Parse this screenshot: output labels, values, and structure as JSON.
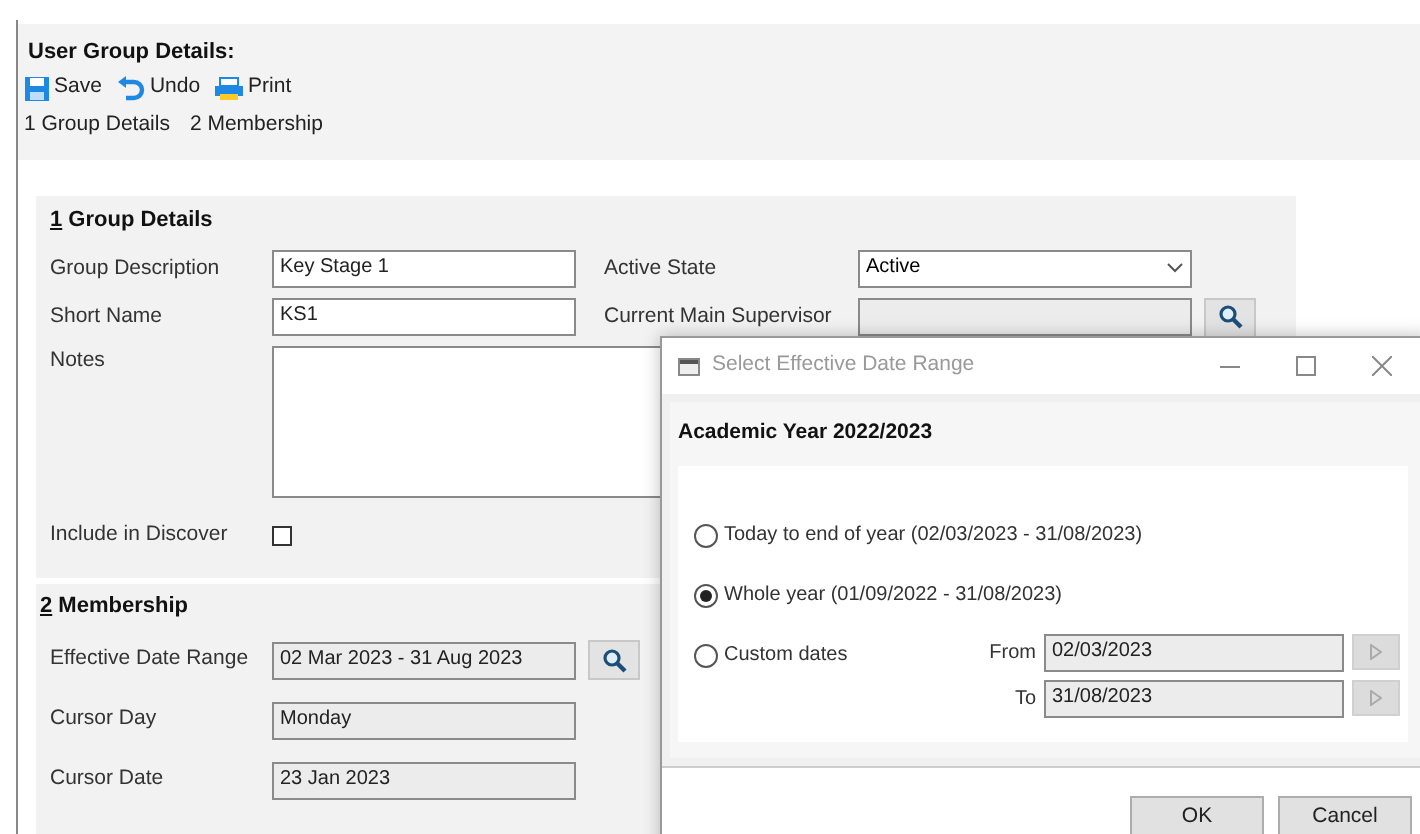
{
  "page_title": "User Group Details:",
  "toolbar": [
    {
      "kind": "save",
      "label": "Save"
    },
    {
      "kind": "undo",
      "label": "Undo"
    },
    {
      "kind": "print",
      "label": "Print"
    }
  ],
  "tabs": [
    {
      "label": "1 Group Details"
    },
    {
      "label": "2 Membership"
    }
  ],
  "group_details": {
    "title_key": "1",
    "title": " Group Details",
    "group_description": {
      "label": "Group Description",
      "value": "Key Stage 1"
    },
    "short_name": {
      "label": "Short Name",
      "value": "KS1"
    },
    "active_state": {
      "label": "Active State",
      "value": "Active"
    },
    "current_main_supervisor": {
      "label": "Current Main Supervisor"
    },
    "notes": {
      "label": "Notes"
    },
    "include_in_discover": {
      "label": "Include in Discover",
      "checked": false
    }
  },
  "membership": {
    "title_key": "2",
    "title": " Membership",
    "effective_date_range": {
      "label": "Effective Date Range",
      "value": "02 Mar 2023 - 31 Aug 2023"
    },
    "cursor_day": {
      "label": "Cursor Day",
      "value": "Monday"
    },
    "cursor_date": {
      "label": "Cursor Date",
      "value": "23 Jan 2023"
    }
  },
  "dialog": {
    "title": "Select Effective Date Range",
    "heading": "Academic Year 2022/2023",
    "options": [
      {
        "label": "Today to end of year (02/03/2023 - 31/08/2023)",
        "selected": false
      },
      {
        "label": "Whole year (01/09/2022 - 31/08/2023)",
        "selected": true
      },
      {
        "label": "Custom dates",
        "selected": false
      }
    ],
    "from": {
      "label": "From",
      "value": "02/03/2023"
    },
    "to": {
      "label": "To",
      "value": "31/08/2023"
    },
    "buttons": [
      "OK",
      "Cancel"
    ]
  }
}
